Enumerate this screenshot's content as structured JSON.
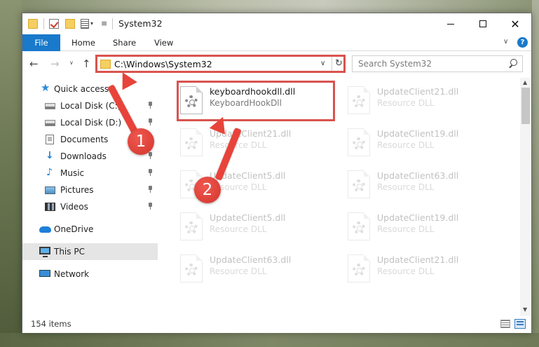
{
  "window": {
    "title": "System32",
    "controls": {
      "minimize": "—",
      "maximize": "☐",
      "close": "✕"
    }
  },
  "ribbon": {
    "tabs": [
      {
        "label": "File"
      },
      {
        "label": "Home"
      },
      {
        "label": "Share"
      },
      {
        "label": "View"
      }
    ],
    "help": "?"
  },
  "navigation": {
    "address": "C:\\Windows\\System32",
    "search_placeholder": "Search System32"
  },
  "sidebar": {
    "items": [
      {
        "label": "Quick access",
        "icon": "star-icon"
      },
      {
        "label": "Local Disk (C:)",
        "icon": "disk-icon",
        "pinned": true
      },
      {
        "label": "Local Disk (D:)",
        "icon": "disk-icon",
        "pinned": true
      },
      {
        "label": "Documents",
        "icon": "documents-icon",
        "pinned": true
      },
      {
        "label": "Downloads",
        "icon": "download-icon",
        "pinned": true
      },
      {
        "label": "Music",
        "icon": "music-icon",
        "pinned": true
      },
      {
        "label": "Pictures",
        "icon": "pictures-icon",
        "pinned": true
      },
      {
        "label": "Videos",
        "icon": "videos-icon",
        "pinned": true
      },
      {
        "label": "OneDrive",
        "icon": "cloud-icon"
      },
      {
        "label": "This PC",
        "icon": "computer-icon",
        "selected": true
      },
      {
        "label": "Network",
        "icon": "network-icon"
      }
    ]
  },
  "files": [
    {
      "name": "keyboardhookdll.dll",
      "type": "KeyboardHookDll",
      "highlighted": true
    },
    {
      "name": "UpdateClient21.dll",
      "type": "Resource DLL"
    },
    {
      "name": "UpdateClient21.dll",
      "type": "Resource DLL"
    },
    {
      "name": "UpdateClient19.dll",
      "type": "Resource DLL"
    },
    {
      "name": "UpdateClient5.dll",
      "type": "Resource DLL"
    },
    {
      "name": "UpdateClient63.dll",
      "type": "Resource DLL"
    },
    {
      "name": "UpdateClient5.dll",
      "type": "Resource DLL"
    },
    {
      "name": "UpdateClient19.dll",
      "type": "Resource DLL"
    },
    {
      "name": "UpdateClient63.dll",
      "type": "Resource DLL"
    },
    {
      "name": "UpdateClient21.dll",
      "type": "Resource DLL"
    }
  ],
  "status": {
    "item_count": "154 items"
  },
  "annotations": {
    "step1": "1",
    "step2": "2"
  },
  "colors": {
    "accent": "#1979ca",
    "highlight": "#d9534f",
    "annotation": "#e8433a"
  }
}
